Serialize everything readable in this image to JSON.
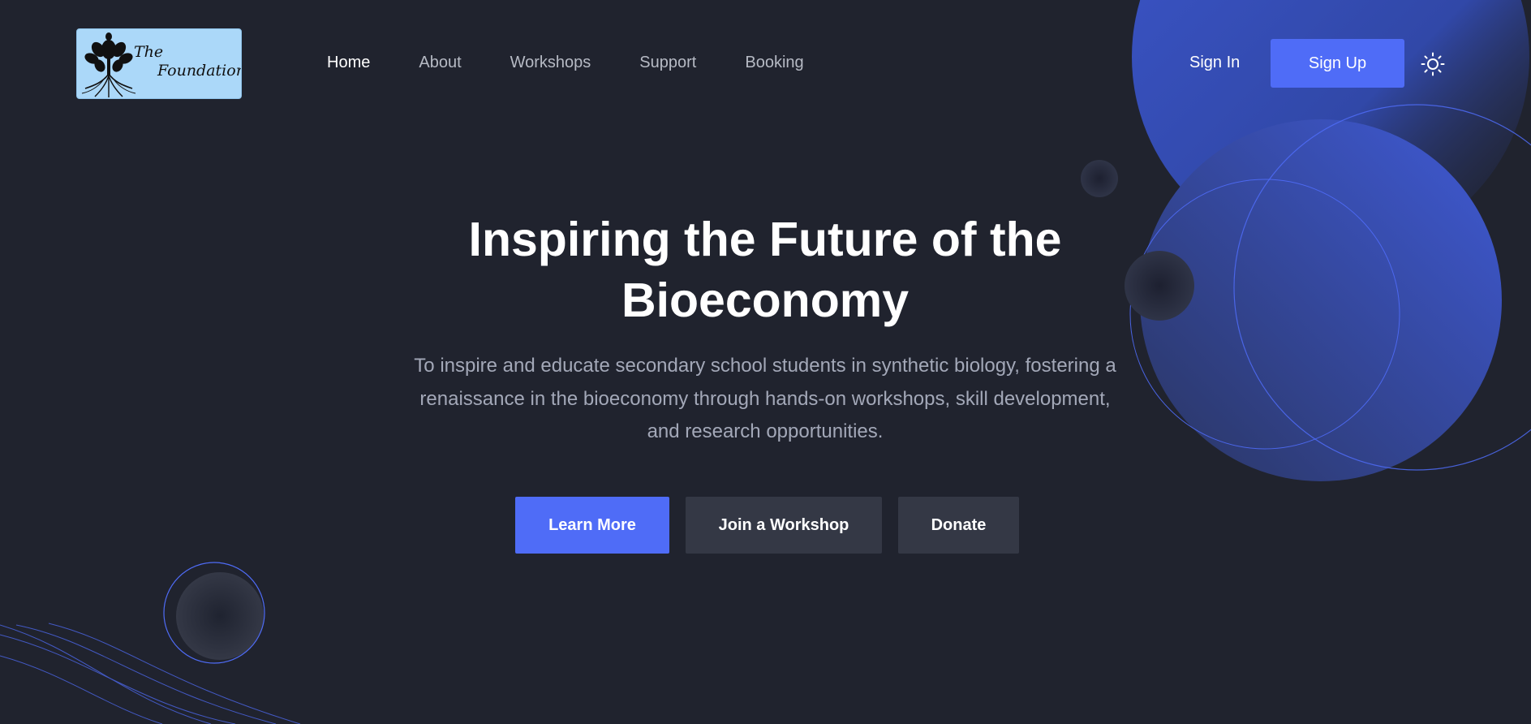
{
  "logo": {
    "word1": "The",
    "word2": "Foundation",
    "background": "#abd8f9"
  },
  "nav": {
    "items": [
      {
        "label": "Home",
        "active": true
      },
      {
        "label": "About",
        "active": false
      },
      {
        "label": "Workshops",
        "active": false
      },
      {
        "label": "Support",
        "active": false
      },
      {
        "label": "Booking",
        "active": false
      }
    ]
  },
  "auth": {
    "sign_in": "Sign In",
    "sign_up": "Sign Up"
  },
  "theme_toggle": {
    "icon": "sun-icon"
  },
  "hero": {
    "title_line1": "Inspiring the Future of the",
    "title_line2": "Bioeconomy",
    "subtitle_line1": "To inspire and educate secondary school students in synthetic biology, fostering a",
    "subtitle_line2": "renaissance in the bioeconomy through hands-on workshops, skill development,",
    "subtitle_line3": "and research opportunities."
  },
  "actions": {
    "learn_more": "Learn More",
    "join_workshop": "Join a Workshop",
    "donate": "Donate"
  },
  "colors": {
    "background": "#20232e",
    "accent": "#4f6cf7",
    "secondary_button": "#343845",
    "muted_text": "#a3a8b8"
  }
}
